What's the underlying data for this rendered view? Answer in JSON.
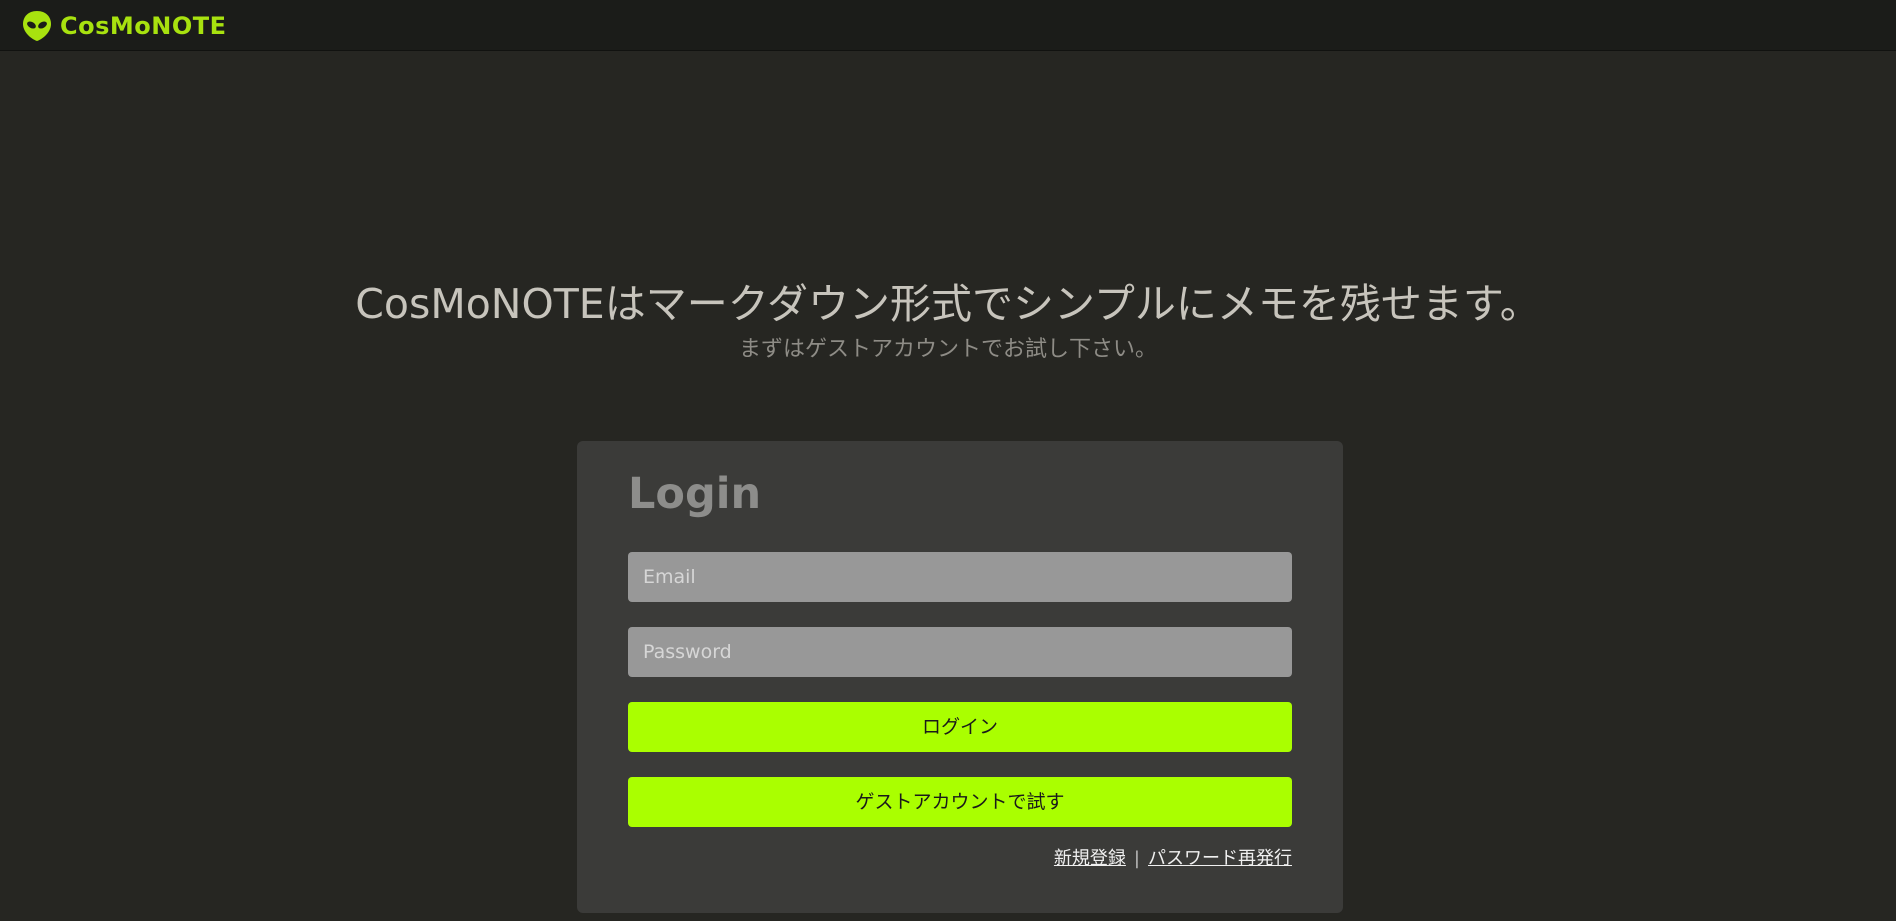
{
  "header": {
    "brand": "CosMoNOTE",
    "logo_icon": "alien-head-icon",
    "brand_color": "#a8e20f"
  },
  "hero": {
    "title": "CosMoNOTEはマークダウン形式でシンプルにメモを残せます。",
    "subtitle": "まずはゲストアカウントでお試し下さい。"
  },
  "login": {
    "title": "Login",
    "email_placeholder": "Email",
    "password_placeholder": "Password",
    "login_button": "ログイン",
    "guest_button": "ゲストアカウントで試す",
    "register_link": "新規登録",
    "separator": "|",
    "reset_link": "パスワード再発行",
    "accent_color": "#aaff00"
  }
}
